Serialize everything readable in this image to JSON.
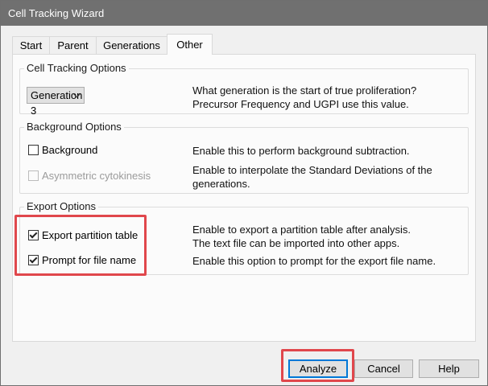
{
  "window": {
    "title": "Cell Tracking Wizard"
  },
  "tabs": [
    {
      "label": "Start"
    },
    {
      "label": "Parent"
    },
    {
      "label": "Generations"
    },
    {
      "label": "Other",
      "active": true
    }
  ],
  "cell_tracking": {
    "title": "Cell Tracking Options",
    "generation_select": {
      "value": "Generation 3"
    },
    "description_line1": "What generation is the start of true proliferation?",
    "description_line2": "Precursor Frequency and UGPI use this value."
  },
  "background": {
    "title": "Background Options",
    "background_checkbox": {
      "label": "Background",
      "checked": false
    },
    "background_desc": "Enable this to perform background subtraction.",
    "asym_checkbox": {
      "label": "Asymmetric cytokinesis",
      "checked": false,
      "disabled": true
    },
    "asym_desc_line1": "Enable to interpolate the Standard Deviations of the",
    "asym_desc_line2": "generations."
  },
  "export": {
    "title": "Export Options",
    "partition_checkbox": {
      "label": "Export partition table",
      "checked": true
    },
    "partition_desc_line1": "Enable to export a partition table after analysis.",
    "partition_desc_line2": "The text file can be imported into other apps.",
    "prompt_checkbox": {
      "label": "Prompt for file name",
      "checked": true
    },
    "prompt_desc": "Enable this option to prompt for the export file name."
  },
  "buttons": {
    "analyze": "Analyze",
    "cancel": "Cancel",
    "help": "Help"
  },
  "colors": {
    "titlebar": "#707070",
    "highlight": "#e0474c",
    "default_button_border": "#0078d7"
  }
}
